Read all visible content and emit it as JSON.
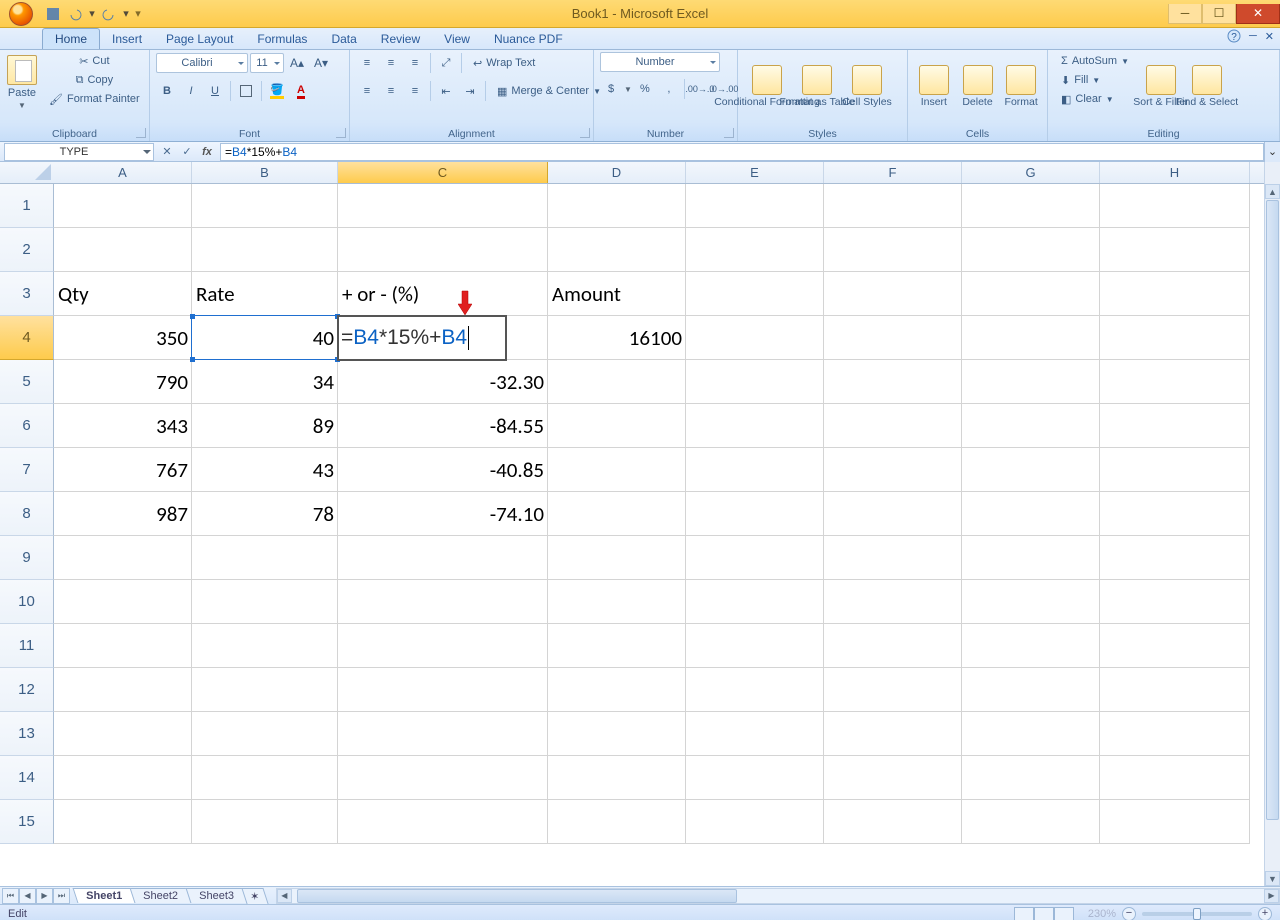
{
  "title": "Book1 - Microsoft Excel",
  "tabs": [
    "Home",
    "Insert",
    "Page Layout",
    "Formulas",
    "Data",
    "Review",
    "View",
    "Nuance PDF"
  ],
  "activeTab": "Home",
  "clipboard": {
    "label": "Clipboard",
    "paste": "Paste",
    "cut": "Cut",
    "copy": "Copy",
    "painter": "Format Painter"
  },
  "font": {
    "label": "Font",
    "name": "Calibri",
    "size": "11",
    "bold": "B",
    "italic": "I",
    "underline": "U"
  },
  "alignment": {
    "label": "Alignment",
    "wrap": "Wrap Text",
    "merge": "Merge & Center"
  },
  "number": {
    "label": "Number",
    "format": "Number",
    "currency": "$",
    "percent": "%",
    "comma": ","
  },
  "styles": {
    "label": "Styles",
    "cf": "Conditional Formatting",
    "ft": "Format as Table",
    "cs": "Cell Styles"
  },
  "cells": {
    "label": "Cells",
    "insert": "Insert",
    "delete": "Delete",
    "format": "Format"
  },
  "editing": {
    "label": "Editing",
    "autosum": "AutoSum",
    "fill": "Fill",
    "clear": "Clear",
    "sort": "Sort & Filter",
    "find": "Find & Select"
  },
  "nameBox": "TYPE",
  "formula": {
    "prefix": "=",
    "r1": "B4",
    "mid": "*15%+",
    "r2": "B4"
  },
  "columns": [
    "A",
    "B",
    "C",
    "D",
    "E",
    "F",
    "G",
    "H"
  ],
  "rowCount": 15,
  "activeRow": 4,
  "activeCol": "C",
  "headers": {
    "A": "Qty",
    "B": "Rate",
    "C": "+ or - (%)",
    "D": "Amount"
  },
  "data": [
    {
      "A": "350",
      "B": "40",
      "C_formula": true,
      "D": "16100"
    },
    {
      "A": "790",
      "B": "34",
      "C": "-32.30"
    },
    {
      "A": "343",
      "B": "89",
      "C": "-84.55"
    },
    {
      "A": "767",
      "B": "43",
      "C": "-40.85"
    },
    {
      "A": "987",
      "B": "78",
      "C": "-74.10"
    }
  ],
  "sheets": [
    "Sheet1",
    "Sheet2",
    "Sheet3"
  ],
  "activeSheet": "Sheet1",
  "status": "Edit",
  "zoom": "230%"
}
